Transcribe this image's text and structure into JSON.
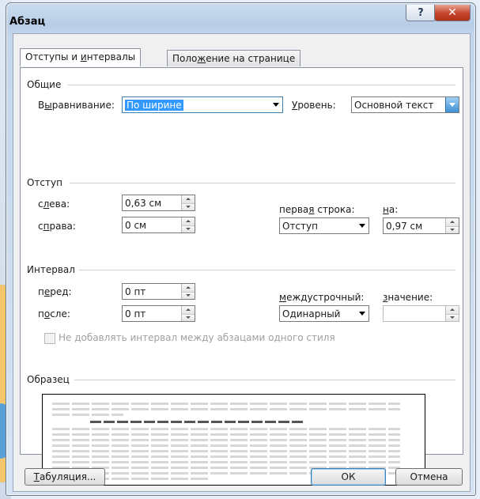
{
  "window": {
    "title": "Абзац",
    "help_glyph": "?",
    "close_glyph": "✕"
  },
  "tabs": [
    {
      "label_pre": "Отступы и ",
      "label_key": "и",
      "label_post": "нтервалы",
      "active": true
    },
    {
      "label_pre": "Поло",
      "label_key": "ж",
      "label_post": "ение на странице",
      "active": false
    }
  ],
  "general": {
    "heading": "Общие",
    "alignment_label_pre": "В",
    "alignment_label_key": "ы",
    "alignment_label_post": "равнивание:",
    "alignment_value": "По ширине",
    "level_label_pre": "",
    "level_label_key": "У",
    "level_label_post": "ровень:",
    "level_value": "Основной текст"
  },
  "indent": {
    "heading": "Отступ",
    "left_label_pre": "с",
    "left_label_key": "л",
    "left_label_post": "ева:",
    "left_value": "0,63 см",
    "right_label_pre": "с",
    "right_label_key": "п",
    "right_label_post": "рава:",
    "right_value": "0 см",
    "first_line_label_pre": "перва",
    "first_line_label_key": "я",
    "first_line_label_post": " строка:",
    "first_line_value": "Отступ",
    "by_label_pre": "",
    "by_label_key": "н",
    "by_label_post": "а:",
    "by_value": "0,97 см"
  },
  "spacing": {
    "heading": "Интервал",
    "before_label_pre": "п",
    "before_label_key": "е",
    "before_label_post": "ред:",
    "before_value": "0 пт",
    "after_label_pre": "п",
    "after_label_key": "о",
    "after_label_post": "сле:",
    "after_value": "0 пт",
    "line_label_pre": "",
    "line_label_key": "м",
    "line_label_post": "еждустрочный:",
    "line_value": "Одинарный",
    "value_label_pre": "",
    "value_label_key": "з",
    "value_label_post": "начение:",
    "value_value": "",
    "no_space_label": "Не добавлять интервал между абзацами одного стиля",
    "no_space_checked": false
  },
  "sample": {
    "heading": "Образец"
  },
  "buttons": {
    "tabs_pre": "",
    "tabs_key": "Т",
    "tabs_post": "абуляция...",
    "ok": "ОК",
    "cancel": "Отмена"
  },
  "colors": {
    "selection": "#3399ff",
    "close_button": "#c4432b"
  }
}
